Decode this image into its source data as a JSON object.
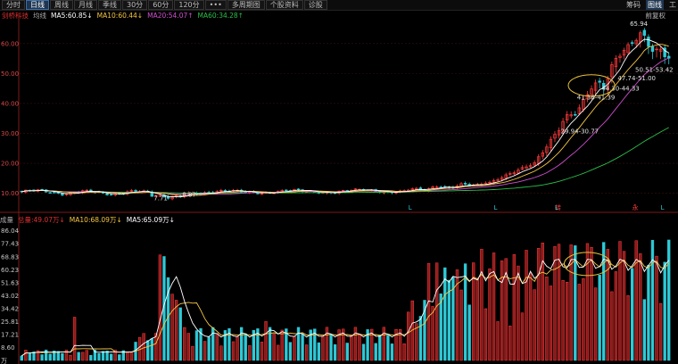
{
  "toolbar": {
    "tabs": [
      "分时",
      "日线",
      "周线",
      "月线",
      "季线",
      "30分",
      "60分",
      "120分",
      "•••",
      "多周期图",
      "个股资料",
      "诊股"
    ],
    "active_tab": 1,
    "right": [
      "筹码",
      "图线",
      "工"
    ],
    "active_right": 1,
    "small_right": "前复权"
  },
  "legend_price": {
    "stock": "剑桥科技",
    "type": "均线",
    "ma5": "MA5:60.85↓",
    "ma10": "MA10:60.44↓",
    "ma20": "MA20:54.07↑",
    "ma60": "MA60:34.28↑"
  },
  "legend_volume": {
    "label": "成量",
    "vol": "总量:49.07万↓",
    "ma10": "MA10:68.09万↓",
    "ma5": "MA5:65.09万↓"
  },
  "colors": {
    "up": "#ff3b3b",
    "down": "#2ec9d6",
    "ma5": "#ffffff",
    "ma10": "#f5c542",
    "ma20": "#d04fd0",
    "ma60": "#2bbf4a",
    "tick": "#d84a4a",
    "bg": "#000000"
  },
  "chart_data": [
    {
      "type": "candlestick",
      "title": "",
      "y_ticks": [
        10.0,
        20.0,
        30.0,
        40.0,
        50.0,
        60.0
      ],
      "y_tick_labels": [
        "10.00",
        "20.00",
        "30.00",
        "40.00",
        "50.00",
        "60.00"
      ],
      "ylim": [
        6,
        68
      ],
      "x_markers": [
        {
          "label": "L",
          "index": 95,
          "color": "#2ec9d6"
        },
        {
          "label": "L",
          "index": 116,
          "color": "#2ec9d6"
        },
        {
          "label": "转",
          "index": 131,
          "color": "#ff3b3b",
          "boxed": true
        },
        {
          "label": "L",
          "index": 131,
          "color": "#2ec9d6"
        },
        {
          "label": "永",
          "index": 150,
          "color": "#ff3b3b",
          "boxed": true
        },
        {
          "label": "L",
          "index": 157,
          "color": "#2ec9d6"
        }
      ],
      "annotations": [
        {
          "text": "65.94",
          "index": 149
        },
        {
          "text": "50.51-53.42",
          "index": 152
        },
        {
          "text": "47.74-51.00",
          "index": 146
        },
        {
          "text": "44.30-44.33",
          "index": 142
        },
        {
          "text": "41.36-41.39",
          "index": 136
        },
        {
          "text": "29.94-30.77",
          "index": 132
        },
        {
          "text": "7.71",
          "index": 32
        },
        {
          "text": "8.87",
          "index": 39
        }
      ],
      "candles": [],
      "ma5": [],
      "ma10": [],
      "ma20": [],
      "ma60": []
    },
    {
      "type": "bar",
      "title": "",
      "y_tick_labels": [
        "86.04",
        "77.43",
        "68.83",
        "60.23",
        "51.63",
        "43.02",
        "34.42",
        "25.81",
        "17.21",
        "8.60",
        "万"
      ],
      "y_ticks": [
        86.04,
        77.43,
        68.83,
        60.23,
        51.63,
        43.02,
        34.42,
        25.81,
        17.21,
        8.6,
        0
      ],
      "ylim": [
        0,
        90
      ],
      "volumes": [],
      "ma5": [],
      "ma10": []
    }
  ]
}
